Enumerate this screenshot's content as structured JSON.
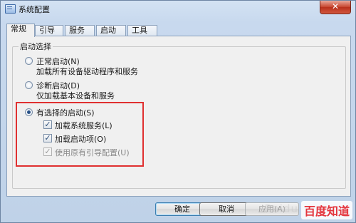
{
  "window": {
    "title": "系统配置",
    "close_glyph": "✕"
  },
  "tabs": [
    {
      "label": "常规",
      "active": true
    },
    {
      "label": "引导",
      "active": false
    },
    {
      "label": "服务",
      "active": false
    },
    {
      "label": "启动",
      "active": false
    },
    {
      "label": "工具",
      "active": false
    }
  ],
  "startup": {
    "group_label": "启动选择",
    "normal": {
      "label": "正常启动(N)",
      "desc": "加载所有设备驱动程序和服务",
      "selected": false
    },
    "diagnostic": {
      "label": "诊断启动(D)",
      "desc": "仅加载基本设备和服务",
      "selected": false
    },
    "selective": {
      "label": "有选择的启动(S)",
      "selected": true,
      "options": [
        {
          "label": "加载系统服务(L)",
          "checked": true,
          "enabled": true
        },
        {
          "label": "加载启动项(O)",
          "checked": true,
          "enabled": true
        },
        {
          "label": "使用原有引导配置(U)",
          "checked": true,
          "enabled": false
        }
      ]
    }
  },
  "buttons": {
    "ok": "确定",
    "cancel": "取消",
    "apply": "应用(A)"
  },
  "annotation_color": "#e03030",
  "watermark": {
    "brand": "百度知道",
    "url": "Baidu"
  }
}
